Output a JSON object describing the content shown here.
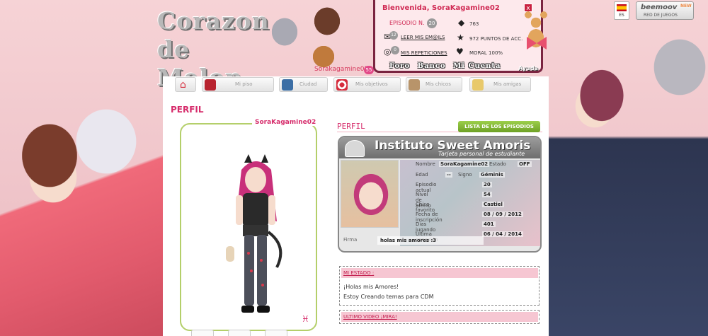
{
  "site": {
    "logo_line1": "Corazon",
    "logo_line2": "de Melon",
    "logo_sub": "Sorakagamine02",
    "logo_badge": "55"
  },
  "user_panel": {
    "welcome": "Bienvenida, SoraKagamine02",
    "close": "x",
    "episode_label": "EPISODIO N.",
    "episode_number": "20",
    "messages_count": "12",
    "messages_link": "LEER MIS EM@ILS",
    "repeats_count": "0",
    "repeats_link": "MIS REPETICIONES",
    "stat_1": "763",
    "stat_2": "972 PUNTOS DE ACC.",
    "stat_3": "MORAL 100%"
  },
  "foro_bar": {
    "foro": "Foro",
    "banco": "Banco",
    "cuenta": "Mi Cuenta",
    "ayuda": "Ayuda"
  },
  "lang": {
    "code": "ES"
  },
  "beemoov": {
    "name": "beemoov",
    "sub": "RED DE JUEGOS",
    "new": "NEW"
  },
  "nav": {
    "items": [
      {
        "label": ""
      },
      {
        "label": "Mi piso"
      },
      {
        "label": "Ciudad"
      },
      {
        "label": "Mis objetivos"
      },
      {
        "label": "Mis chicos"
      },
      {
        "label": "Mis amigas"
      }
    ]
  },
  "profile": {
    "section_title": "PERFIL",
    "avatar_name": "SoraKagamine02",
    "perfil_sub": "PERFIL",
    "episode_list_button": "LISTA DE LOS EPISODIOS",
    "card_title": "Instituto Sweet Amoris",
    "card_subtitle": "Tarjeta personal de estudiante",
    "rows": [
      {
        "key": "Nombre",
        "value": "SoraKagamine02"
      },
      {
        "key": "Estado",
        "value": "OFF"
      },
      {
        "key": "Edad",
        "value": "--"
      },
      {
        "key": "Signo",
        "value": "Géminis"
      },
      {
        "key": "Episodio actual",
        "value": "20"
      },
      {
        "key": "Nivel de afecto",
        "value": "54"
      },
      {
        "key": "Chico favorito",
        "value": "Castiel"
      },
      {
        "key": "Fecha de inscripción",
        "value": "08 / 09 / 2012"
      },
      {
        "key": "Días jugando",
        "value": "401"
      },
      {
        "key": "Última conexión",
        "value": "06 / 04 / 2014"
      }
    ],
    "firma_key": "Firma",
    "firma_value": "holas mis amores :3"
  },
  "estado": {
    "head": "MI ESTADO :",
    "line1": "¡Holas mis Amores!",
    "line2": "Estoy Creando temas para CDM"
  },
  "video": {
    "head": "ULTIMO VIDEO ¡MIRA!"
  }
}
